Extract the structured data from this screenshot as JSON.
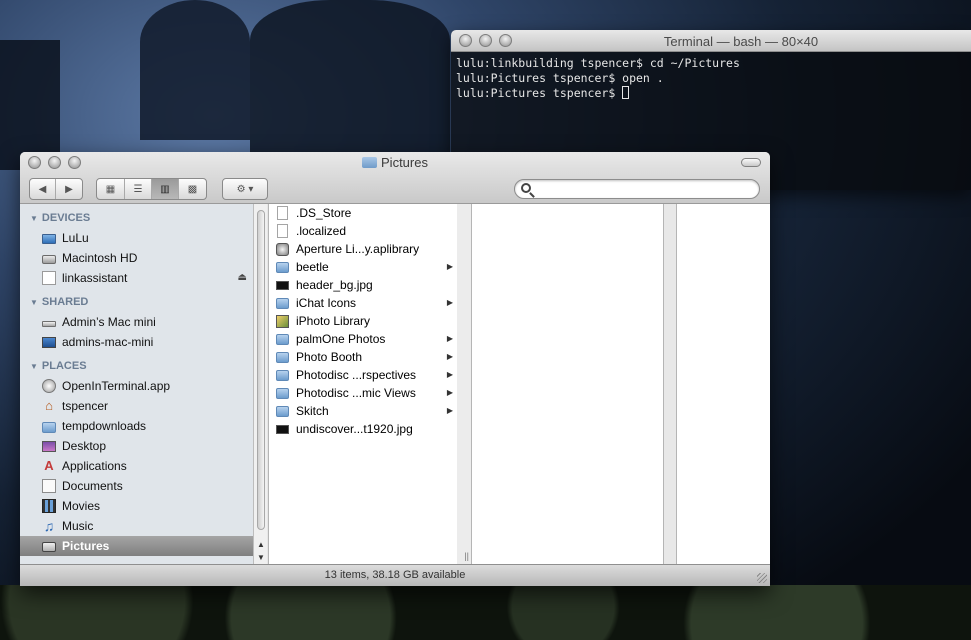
{
  "terminal": {
    "title": "Terminal — bash — 80×40",
    "lines": [
      "lulu:linkbuilding tspencer$ cd ~/Pictures",
      "lulu:Pictures tspencer$ open .",
      "lulu:Pictures tspencer$ "
    ]
  },
  "finder": {
    "title": "Pictures",
    "search": {
      "value": "",
      "placeholder": ""
    },
    "toolbar": {
      "back": "◀",
      "forward": "▶",
      "view_icon": "▦",
      "view_list": "☰",
      "view_column": "▥",
      "view_coverflow": "▩",
      "action": "⚙ ▾"
    },
    "sidebar": {
      "sections": [
        {
          "label": "DEVICES",
          "items": [
            {
              "label": "LuLu",
              "icon": "laptop-icon"
            },
            {
              "label": "Macintosh HD",
              "icon": "hard-drive-icon"
            },
            {
              "label": "linkassistant",
              "icon": "disk-image-icon"
            }
          ]
        },
        {
          "label": "SHARED",
          "items": [
            {
              "label": "Admin’s Mac mini",
              "icon": "mac-mini-icon"
            },
            {
              "label": "admins-mac-mini",
              "icon": "monitor-icon"
            }
          ]
        },
        {
          "label": "PLACES",
          "items": [
            {
              "label": "OpenInTerminal.app",
              "icon": "app-icon"
            },
            {
              "label": "tspencer",
              "icon": "home-icon"
            },
            {
              "label": "tempdownloads",
              "icon": "folder-icon"
            },
            {
              "label": "Desktop",
              "icon": "desktop-icon"
            },
            {
              "label": "Applications",
              "icon": "applications-icon"
            },
            {
              "label": "Documents",
              "icon": "documents-icon"
            },
            {
              "label": "Movies",
              "icon": "movies-icon"
            },
            {
              "label": "Music",
              "icon": "music-icon"
            },
            {
              "label": "Pictures",
              "icon": "pictures-icon"
            }
          ]
        }
      ],
      "eject": "⏏"
    },
    "column_items": [
      {
        "label": ".DS_Store",
        "type": "doc",
        "folder": false
      },
      {
        "label": ".localized",
        "type": "doc",
        "folder": false
      },
      {
        "label": "Aperture Li...y.aplibrary",
        "type": "lib",
        "folder": false
      },
      {
        "label": "beetle",
        "type": "folder",
        "folder": true
      },
      {
        "label": "header_bg.jpg",
        "type": "jpg",
        "folder": false
      },
      {
        "label": "iChat Icons",
        "type": "folder",
        "folder": true
      },
      {
        "label": "iPhoto Library",
        "type": "iphoto",
        "folder": false
      },
      {
        "label": "palmOne Photos",
        "type": "folder",
        "folder": true
      },
      {
        "label": "Photo Booth",
        "type": "folder",
        "folder": true
      },
      {
        "label": "Photodisc ...rspectives",
        "type": "folder",
        "folder": true
      },
      {
        "label": "Photodisc ...mic Views",
        "type": "folder",
        "folder": true
      },
      {
        "label": "Skitch",
        "type": "folder",
        "folder": true
      },
      {
        "label": "undiscover...t1920.jpg",
        "type": "jpg",
        "folder": false
      }
    ],
    "status": "13 items, 38.18 GB available"
  }
}
